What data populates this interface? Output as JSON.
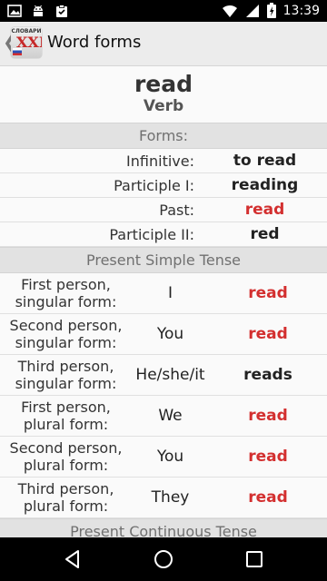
{
  "status_bar": {
    "time": "13:39",
    "left_icons": [
      "image-icon",
      "android-icon",
      "clipboard-check-icon"
    ],
    "right_icons": [
      "wifi-icon",
      "cell-signal-icon",
      "battery-charging-icon"
    ]
  },
  "app_bar": {
    "back_glyph": "❮",
    "logo": {
      "top_text": "СЛОВАРИ",
      "main_text": "XXI"
    },
    "title": "Word forms"
  },
  "headword": {
    "word": "read",
    "pos": "Verb"
  },
  "forms": {
    "header": "Forms:",
    "rows": [
      {
        "label": "Infinitive:",
        "value": "to read",
        "irregular": false
      },
      {
        "label": "Participle I:",
        "value": "reading",
        "irregular": false
      },
      {
        "label": "Past:",
        "value": "read",
        "irregular": true
      },
      {
        "label": "Participle II:",
        "value": "red",
        "irregular": false
      }
    ]
  },
  "present_simple": {
    "header": "Present Simple Tense",
    "rows": [
      {
        "label_1": "First person,",
        "label_2": "singular form:",
        "pronoun": "I",
        "value": "read",
        "highlight": true
      },
      {
        "label_1": "Second person,",
        "label_2": "singular form:",
        "pronoun": "You",
        "value": "read",
        "highlight": true
      },
      {
        "label_1": "Third person,",
        "label_2": "singular form:",
        "pronoun": "He/she/it",
        "value": "reads",
        "highlight": false
      },
      {
        "label_1": "First person,",
        "label_2": "plural form:",
        "pronoun": "We",
        "value": "read",
        "highlight": true
      },
      {
        "label_1": "Second person,",
        "label_2": "plural form:",
        "pronoun": "You",
        "value": "read",
        "highlight": true
      },
      {
        "label_1": "Third person,",
        "label_2": "plural form:",
        "pronoun": "They",
        "value": "read",
        "highlight": true
      }
    ]
  },
  "present_continuous": {
    "header": "Present Continuous Tense"
  },
  "colors": {
    "highlight": "#d32f2f",
    "section_bg": "#e2e2e2"
  },
  "nav_bar": {
    "buttons": [
      "back-triangle-icon",
      "home-circle-icon",
      "recents-square-icon"
    ]
  }
}
